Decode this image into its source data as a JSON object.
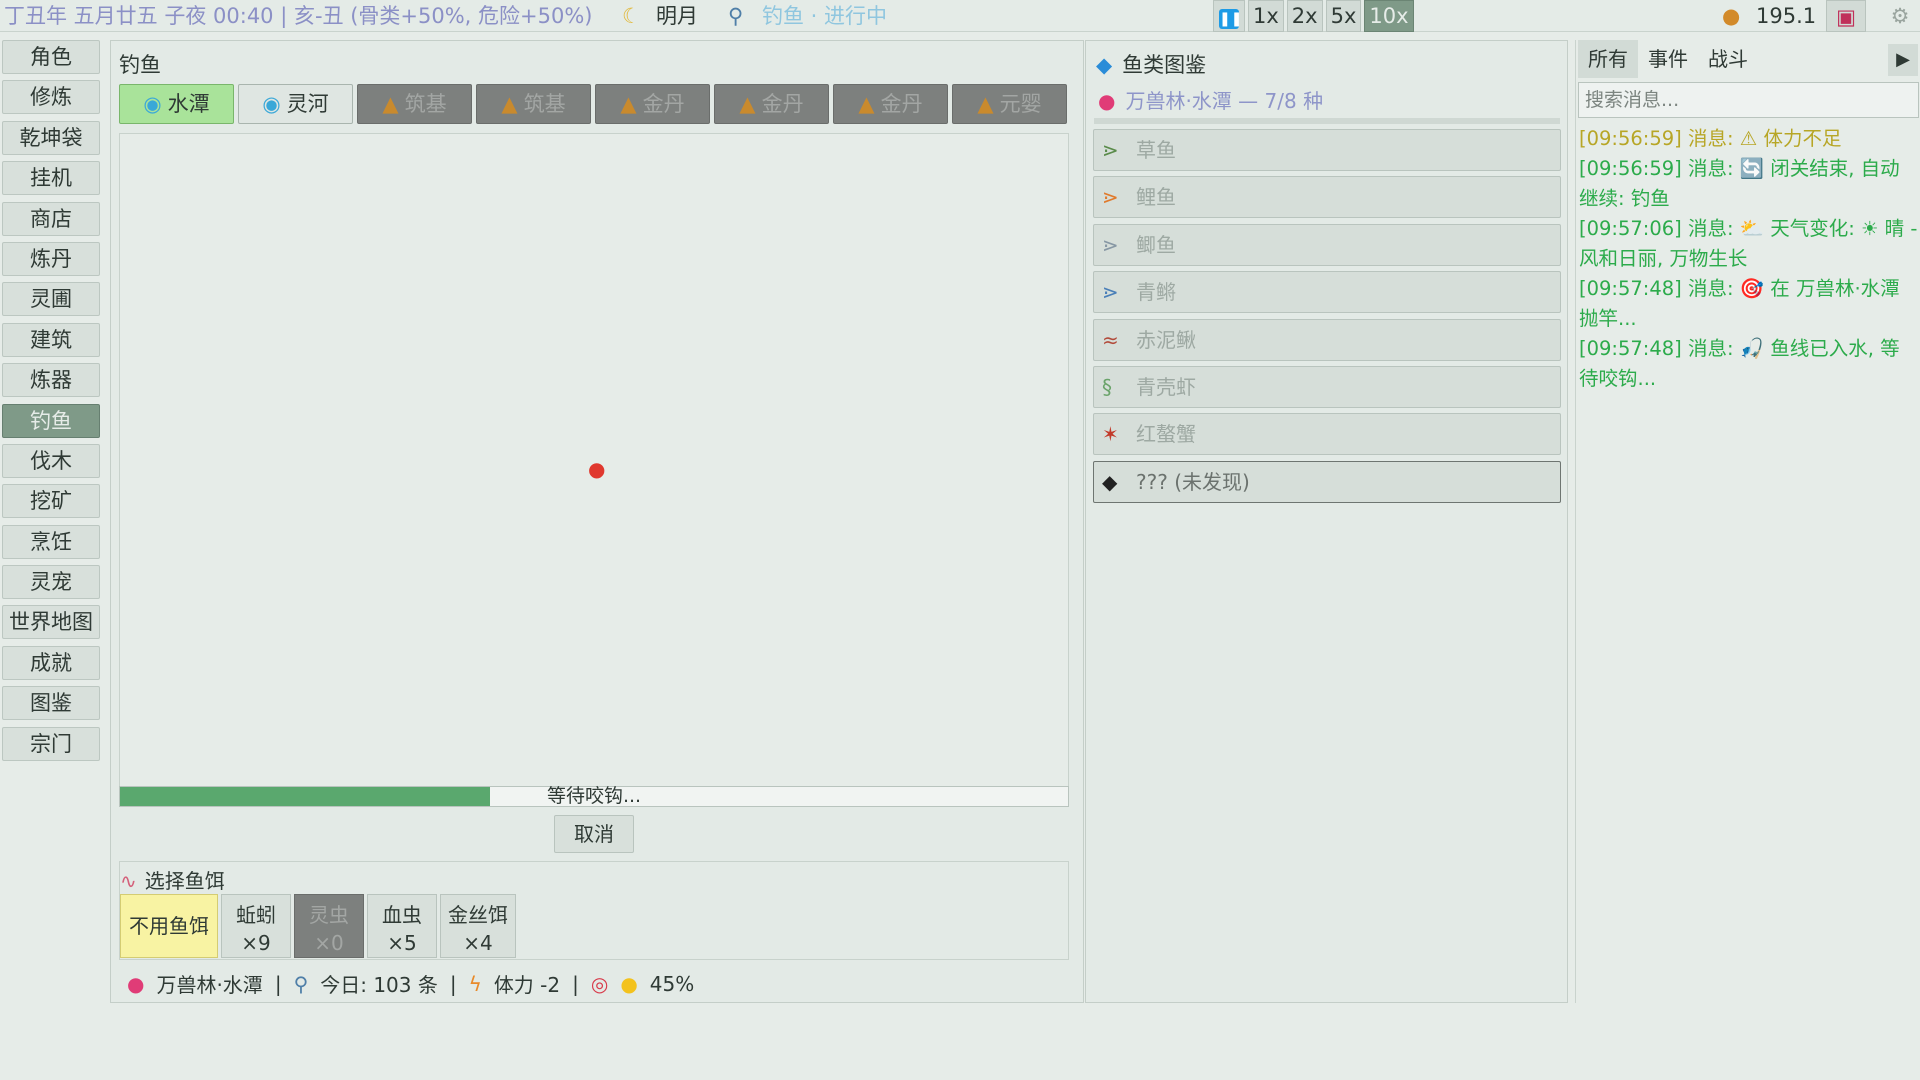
{
  "topbar": {
    "date_info": "丁丑年 五月廿五 子夜 00:40 | 亥-丑 (骨类+50%, 危险+50%)",
    "moon_label": "明月",
    "activity": "钓鱼 · 进行中",
    "speeds": [
      "1x",
      "2x",
      "5x",
      "10x"
    ],
    "active_speed": "10x",
    "coins": "195.1"
  },
  "nav": [
    "角色",
    "修炼",
    "乾坤袋",
    "挂机",
    "商店",
    "炼丹",
    "灵圃",
    "建筑",
    "炼器",
    "钓鱼",
    "伐木",
    "挖矿",
    "烹饪",
    "灵宠",
    "世界地图",
    "成就",
    "图鉴",
    "宗门"
  ],
  "nav_active": "钓鱼",
  "fishing": {
    "title": "钓鱼",
    "locations": [
      {
        "label": "水潭",
        "state": "selected"
      },
      {
        "label": "灵河",
        "state": "open"
      },
      {
        "label": "筑基",
        "state": "locked"
      },
      {
        "label": "筑基",
        "state": "locked"
      },
      {
        "label": "金丹",
        "state": "locked"
      },
      {
        "label": "金丹",
        "state": "locked"
      },
      {
        "label": "金丹",
        "state": "locked"
      },
      {
        "label": "元婴",
        "state": "locked"
      }
    ],
    "progress_label": "等待咬钩...",
    "progress_fraction": 0.39,
    "cancel_label": "取消",
    "bait_title": "选择鱼饵",
    "baits": [
      {
        "name": "不用鱼饵",
        "count": "",
        "state": "selected"
      },
      {
        "name": "蚯蚓",
        "count": "×9",
        "state": "normal"
      },
      {
        "name": "灵虫",
        "count": "×0",
        "state": "disabled"
      },
      {
        "name": "血虫",
        "count": "×5",
        "state": "normal"
      },
      {
        "name": "金丝饵",
        "count": "×4",
        "state": "normal"
      }
    ],
    "status": {
      "location": "万兽林·水潭",
      "today": "今日: 103 条",
      "stamina": "体力 -2",
      "chance": "45%"
    }
  },
  "guide": {
    "title": "鱼类图鉴",
    "subtitle": "万兽林·水潭 — 7/8 种",
    "fish": [
      {
        "name": "草鱼",
        "icon": "fish-icon"
      },
      {
        "name": "鲤鱼",
        "icon": "fish-icon"
      },
      {
        "name": "鲫鱼",
        "icon": "fish-icon"
      },
      {
        "name": "青鳉",
        "icon": "fish-icon"
      },
      {
        "name": "赤泥鳅",
        "icon": "loach-icon"
      },
      {
        "name": "青壳虾",
        "icon": "shrimp-icon"
      },
      {
        "name": "红螯蟹",
        "icon": "crab-icon"
      },
      {
        "name": "??? (未发现)",
        "icon": "unknown-fish-icon"
      }
    ]
  },
  "messages": {
    "tabs": [
      "所有",
      "事件",
      "战斗"
    ],
    "active_tab": "所有",
    "search_placeholder": "搜索消息...",
    "log": [
      {
        "text": "[09:56:59] 消息: ⚠ 体力不足",
        "type": "warn"
      },
      {
        "text": "[09:56:59] 消息: 🔄 闭关结束, 自动继续: 钓鱼",
        "type": "info"
      },
      {
        "text": "[09:57:06] 消息: ⛅ 天气变化: ☀ 晴 - 风和日丽, 万物生长",
        "type": "info"
      },
      {
        "text": "[09:57:48] 消息: 🎯 在 万兽林·水潭 抛竿...",
        "type": "info"
      },
      {
        "text": "[09:57:48] 消息: 🎣 鱼线已入水, 等待咬钩...",
        "type": "info"
      }
    ]
  },
  "colors": {
    "accent_green": "#7f9a88",
    "progress_fill": "#5aa86e",
    "message_green": "#2cab4b",
    "message_warn": "#b7a626",
    "tab_selected": "#a9e39a",
    "bait_selected": "#f8f3a3"
  }
}
